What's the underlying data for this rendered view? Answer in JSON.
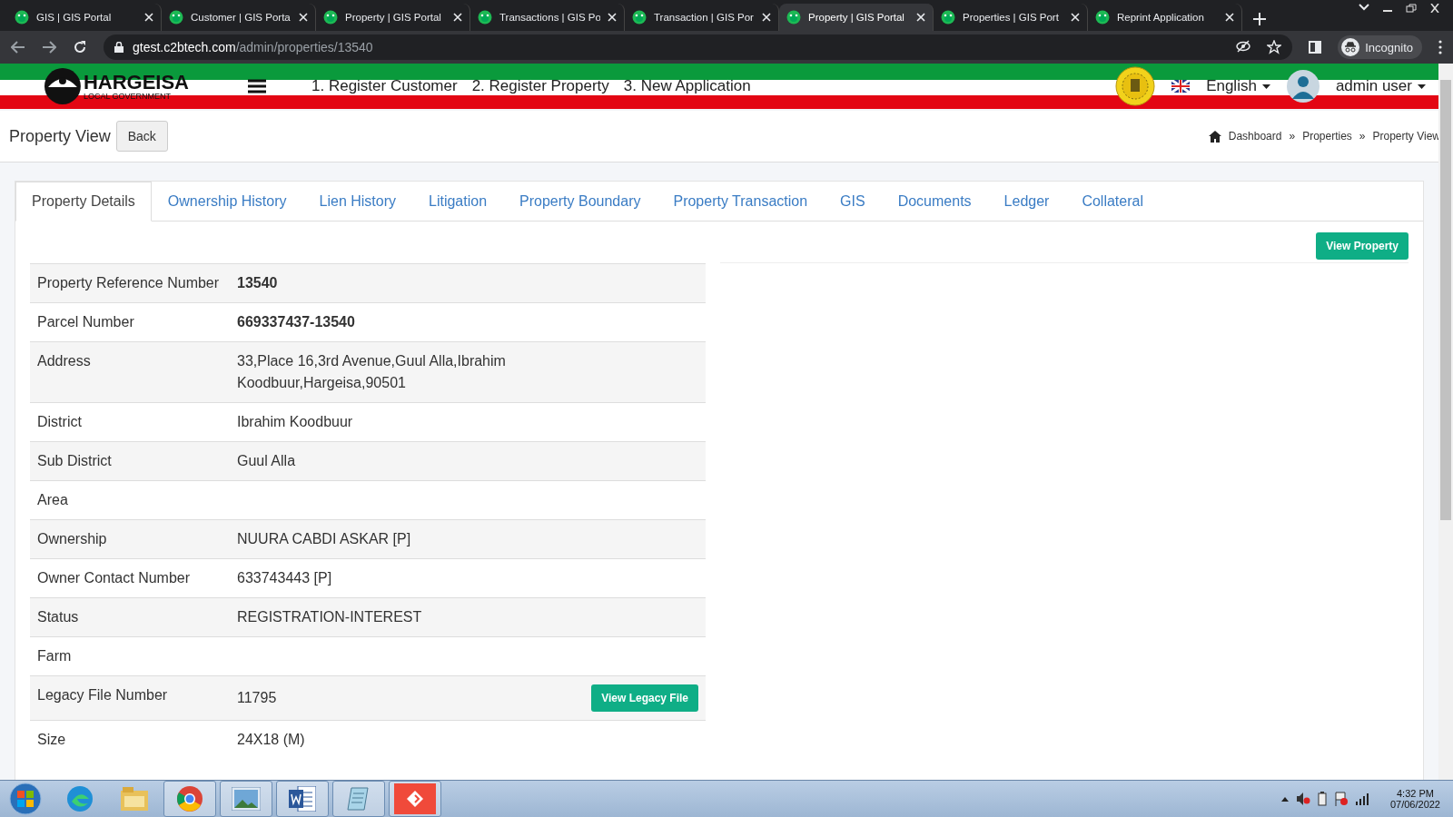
{
  "browser": {
    "tabs": [
      {
        "title": "GIS | GIS Portal",
        "selected": false
      },
      {
        "title": "Customer | GIS Porta",
        "selected": false
      },
      {
        "title": "Property | GIS Portal",
        "selected": false
      },
      {
        "title": "Transactions | GIS Po",
        "selected": false
      },
      {
        "title": "Transaction | GIS Por",
        "selected": false
      },
      {
        "title": "Property | GIS Portal",
        "selected": true
      },
      {
        "title": "Properties | GIS Port",
        "selected": false
      },
      {
        "title": "Reprint Application",
        "selected": false
      }
    ],
    "url_host": "gtest.c2btech.com",
    "url_path": "/admin/properties/13540",
    "profile": "Incognito"
  },
  "header": {
    "logo_text": "HARGEISA",
    "logo_subtext": "LOCAL GOVERNMENT",
    "nav": [
      "1. Register Customer",
      "2. Register Property",
      "3. New Application"
    ],
    "language": "English",
    "user": "admin user"
  },
  "page": {
    "title": "Property View",
    "back": "Back",
    "breadcrumb": [
      "Dashboard",
      "Properties",
      "Property View"
    ],
    "separator": "»"
  },
  "tabs": [
    {
      "label": "Property Details",
      "selected": true
    },
    {
      "label": "Ownership History",
      "selected": false
    },
    {
      "label": "Lien History",
      "selected": false
    },
    {
      "label": "Litigation",
      "selected": false
    },
    {
      "label": "Property Boundary",
      "selected": false
    },
    {
      "label": "Property Transaction",
      "selected": false
    },
    {
      "label": "GIS",
      "selected": false
    },
    {
      "label": "Documents",
      "selected": false
    },
    {
      "label": "Ledger",
      "selected": false
    },
    {
      "label": "Collateral",
      "selected": false
    }
  ],
  "details": [
    {
      "label": "Property Reference Number",
      "value": "13540",
      "bold": true
    },
    {
      "label": "Parcel Number",
      "value": "669337437-13540",
      "bold": true
    },
    {
      "label": "Address",
      "value": "33,Place 16,3rd Avenue,Guul Alla,Ibrahim Koodbuur,Hargeisa,90501",
      "bold": false
    },
    {
      "label": "District",
      "value": "Ibrahim Koodbuur",
      "bold": false
    },
    {
      "label": "Sub District",
      "value": "Guul Alla",
      "bold": false
    },
    {
      "label": "Area"
    },
    {
      "label": "Ownership",
      "value": "NUURA CABDI ASKAR [P]",
      "bold": false
    },
    {
      "label": "Owner Contact Number",
      "value": "633743443 [P]",
      "bold": false
    },
    {
      "label": "Status",
      "value": "REGISTRATION-INTEREST",
      "bold": false
    },
    {
      "label": "Farm"
    },
    {
      "label": "Legacy File Number",
      "value": "11795",
      "bold": false,
      "action": "View Legacy File"
    },
    {
      "label": "Size",
      "value": "24X18 (M)",
      "bold": false
    }
  ],
  "view_property": "View Property",
  "taskbar": {
    "time": "4:32 PM",
    "date": "07/06/2022"
  }
}
